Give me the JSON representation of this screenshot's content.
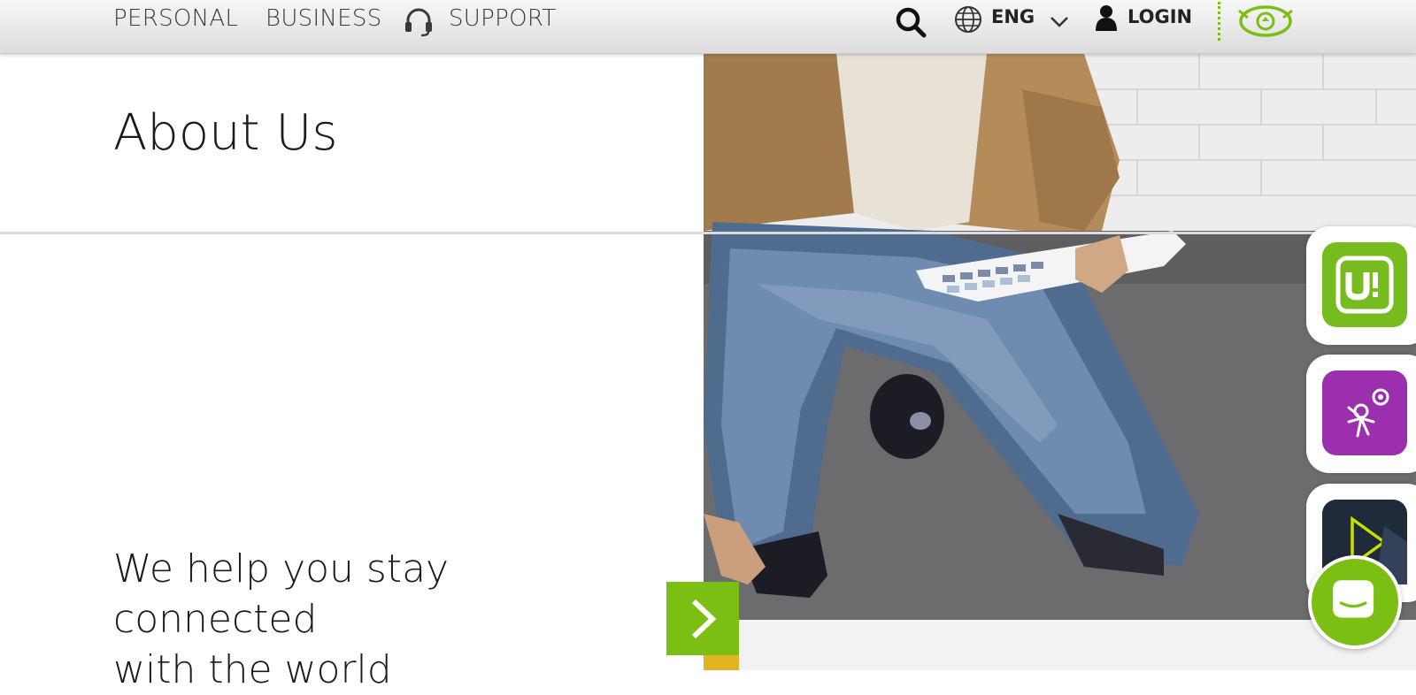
{
  "nav": {
    "personal": "PERSONAL",
    "business": "BUSINESS",
    "support": "SUPPORT",
    "language": "ENG",
    "login": "LOGIN"
  },
  "main": {
    "title": "About Us",
    "tagline_line1": "We help you stay connected",
    "tagline_line2": "with the world"
  },
  "icons": {
    "support": "headset-icon",
    "search": "search-icon",
    "language": "globe-icon",
    "dropdown": "chevron-down-icon",
    "account": "user-icon",
    "brand": "brand-logo-icon",
    "next": "chevron-right-icon",
    "app1": "u-sim-app-icon",
    "app2": "kids-app-icon",
    "app3": "video-play-app-icon",
    "chat": "chat-icon"
  },
  "colors": {
    "accent": "#7cbf14",
    "app_green": "#77bc1f",
    "app_purple": "#9b2fae",
    "app_dark": "#1f2a3a"
  }
}
